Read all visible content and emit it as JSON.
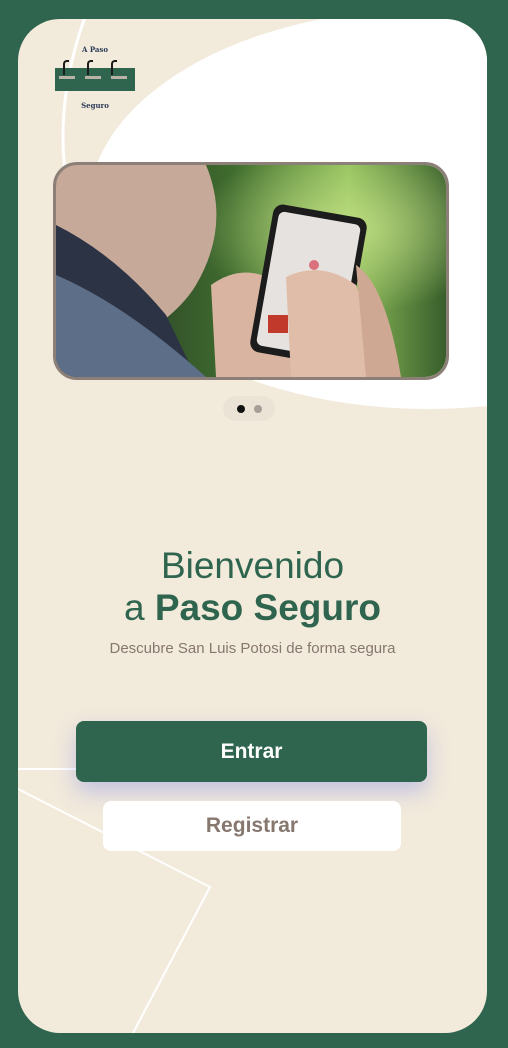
{
  "logo": {
    "top_text": "A Paso",
    "bottom_text": "Seguro"
  },
  "carousel": {
    "image_description": "hands holding a smartphone showing a map app",
    "total_slides": 2,
    "active_slide": 1
  },
  "welcome": {
    "line1": "Bienvenido",
    "line2_prefix": "a ",
    "line2_bold": "Paso Seguro",
    "subtitle": "Descubre San Luis Potosi de forma segura"
  },
  "buttons": {
    "enter_label": "Entrar",
    "register_label": "Registrar"
  },
  "colors": {
    "frame_green": "#2f654e",
    "screen_cream": "#f2eadb",
    "muted_brown": "#86776f",
    "button_white": "#ffffff"
  }
}
